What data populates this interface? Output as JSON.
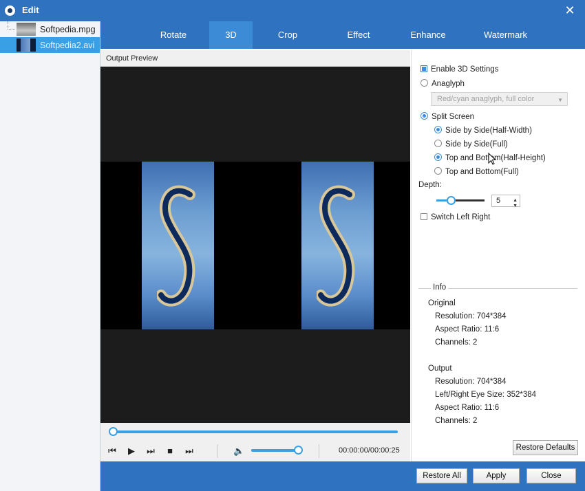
{
  "window": {
    "title": "Edit",
    "close_icon": "close-icon"
  },
  "files": [
    {
      "name": "Softpedia.mpg",
      "selected": false
    },
    {
      "name": "Softpedia2.avi",
      "selected": true
    }
  ],
  "tabs": [
    {
      "label": "Rotate",
      "active": false
    },
    {
      "label": "3D",
      "active": true
    },
    {
      "label": "Crop",
      "active": false
    },
    {
      "label": "Effect",
      "active": false
    },
    {
      "label": "Enhance",
      "active": false
    },
    {
      "label": "Watermark",
      "active": false
    }
  ],
  "preview": {
    "header": "Output Preview",
    "seek_position": 0,
    "volume": 1.0,
    "timecode": "00:00:00/00:00:25",
    "controls": [
      "skip-back-icon",
      "play-icon",
      "fast-forward-icon",
      "stop-icon",
      "skip-end-icon",
      "volume-icon"
    ]
  },
  "settings": {
    "enable_3d": {
      "label": "Enable 3D Settings",
      "checked": true
    },
    "anaglyph": {
      "label": "Anaglyph",
      "checked": false
    },
    "anaglyph_dropdown": {
      "value": "Red/cyan anaglyph, full color",
      "disabled": true
    },
    "split_screen": {
      "label": "Split Screen",
      "checked": true
    },
    "split_options": [
      {
        "label": "Side by Side(Half-Width)",
        "checked": true
      },
      {
        "label": "Side by Side(Full)",
        "checked": false
      },
      {
        "label": "Top and Bottom(Half-Height)",
        "checked": true
      },
      {
        "label": "Top and Bottom(Full)",
        "checked": false
      }
    ],
    "depth": {
      "label": "Depth:",
      "value": "5",
      "slider": 0.2
    },
    "switch_left_right": {
      "label": "Switch Left Right",
      "checked": false
    }
  },
  "info": {
    "legend": "Info",
    "original": {
      "heading": "Original",
      "resolution": "Resolution: 704*384",
      "aspect_ratio": "Aspect Ratio: 11:6",
      "channels": "Channels: 2"
    },
    "output": {
      "heading": "Output",
      "resolution": "Resolution: 704*384",
      "eye_size": "Left/Right Eye Size: 352*384",
      "aspect_ratio": "Aspect Ratio: 11:6",
      "channels": "Channels: 2"
    },
    "restore_defaults": "Restore Defaults"
  },
  "footer": {
    "restore_all": "Restore All",
    "apply": "Apply",
    "close": "Close"
  },
  "colors": {
    "titlebar": "#2f73c0",
    "accent": "#3aa0e4",
    "selected_row": "#39a0e6"
  }
}
